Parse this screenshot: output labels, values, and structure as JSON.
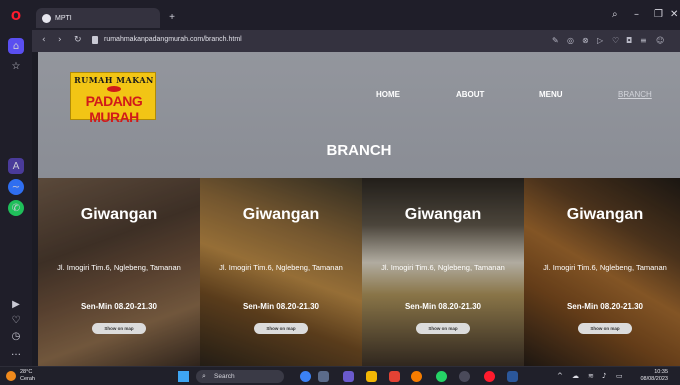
{
  "browser": {
    "tab_title": "MPTI",
    "url": "rumahmakanpadangmurah.com/branch.html"
  },
  "site": {
    "logo_line1": "RUMAH MAKAN",
    "logo_line2": "PADANG MURAH",
    "nav": [
      "HOME",
      "ABOUT",
      "MENU",
      "BRANCH"
    ],
    "page_title": "BRANCH",
    "branches": [
      {
        "name": "Giwangan",
        "address": "Jl. Imogiri Tim.6, Nglebeng, Tamanan",
        "hours": "Sen-Min 08.20-21.30",
        "button": "Show on map"
      },
      {
        "name": "Giwangan",
        "address": "Jl. Imogiri Tim.6, Nglebeng, Tamanan",
        "hours": "Sen-Min 08.20-21.30",
        "button": "Show on map"
      },
      {
        "name": "Giwangan",
        "address": "Jl. Imogiri Tim.6, Nglebeng, Tamanan",
        "hours": "Sen-Min 08.20-21.30",
        "button": "Show on map"
      },
      {
        "name": "Giwangan",
        "address": "Jl. Imogiri Tim.6, Nglebeng, Tamanan",
        "hours": "Sen-Min 08.20-21.30",
        "button": "Show on map"
      }
    ]
  },
  "taskbar": {
    "temperature": "28°C",
    "weather": "Cerah",
    "search_placeholder": "Search",
    "time": "10:35",
    "date": "08/08/2023"
  },
  "colors": {
    "header_bg": "#8b8e96",
    "logo_bg": "#f2c515",
    "logo_red": "#d11a1a",
    "opera_red": "#ff1b2d",
    "browser_chrome": "#1f1e29"
  }
}
